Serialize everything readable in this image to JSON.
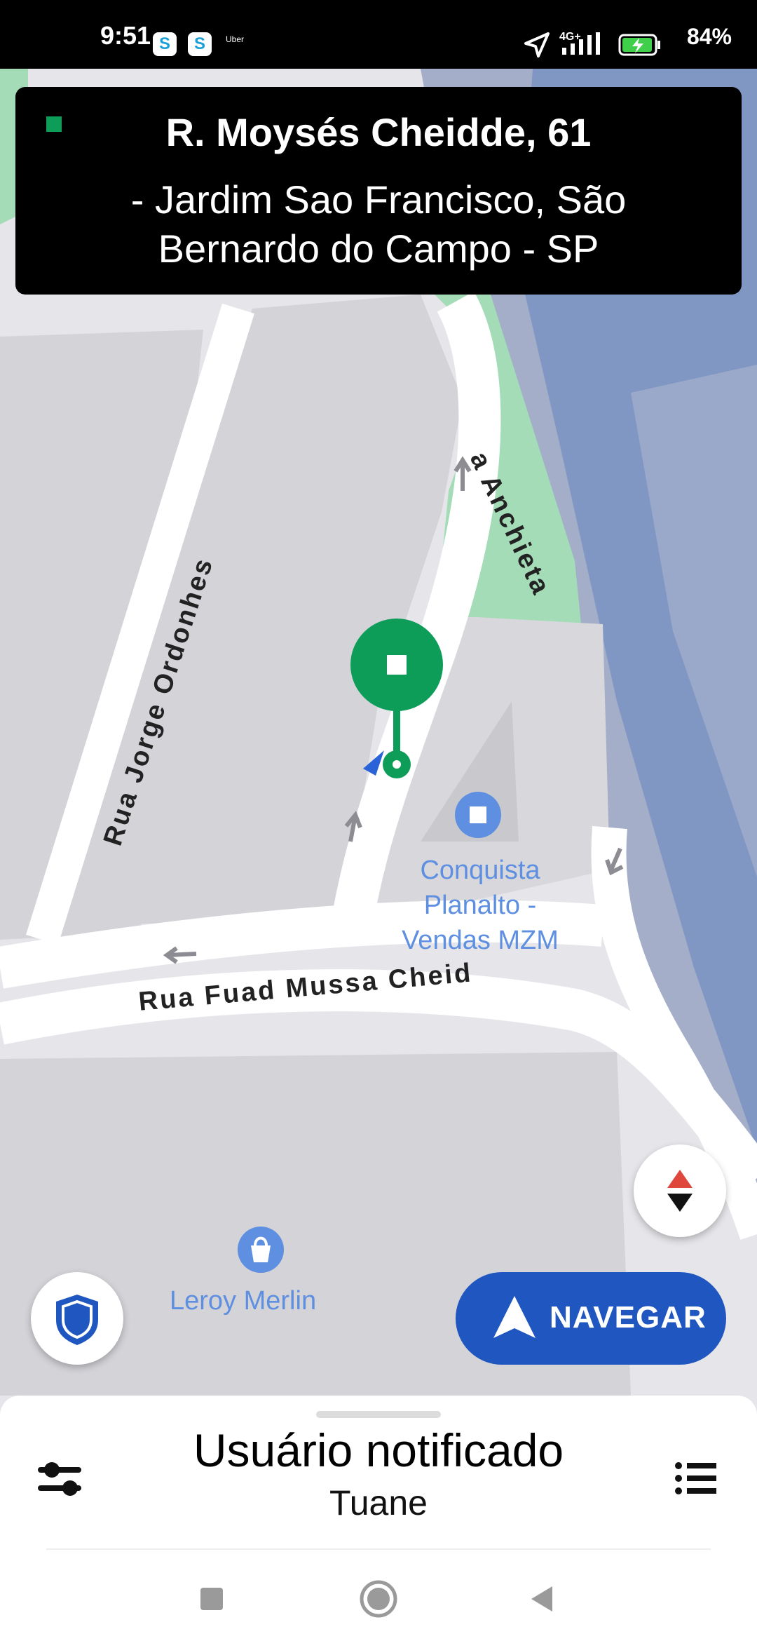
{
  "status_bar": {
    "time": "9:51",
    "app_icons": [
      "S",
      "S"
    ],
    "uber_label": "Uber",
    "network": "4G+",
    "battery": "84%"
  },
  "banner": {
    "street": "R. Moysés Cheidde, 61",
    "locality": "- Jardim Sao Francisco, São Bernardo do Campo - SP"
  },
  "map": {
    "streets": {
      "anchieta": "a Anchieta",
      "jorge": "Rua Jorge Ordonhes",
      "fuad": "Rua Fuad Mussa Cheid"
    },
    "pois": {
      "conquista": [
        "Conquista",
        "Planalto -",
        "Vendas MZM"
      ],
      "leroy": "Leroy Merlin"
    }
  },
  "buttons": {
    "navigate": "NAVEGAR"
  },
  "sheet": {
    "title": "Usuário notificado",
    "subtitle": "Tuane"
  },
  "colors": {
    "accent_blue": "#1f56bf",
    "pin_green": "#0d9d58",
    "poi_blue": "#5e8fe0"
  }
}
